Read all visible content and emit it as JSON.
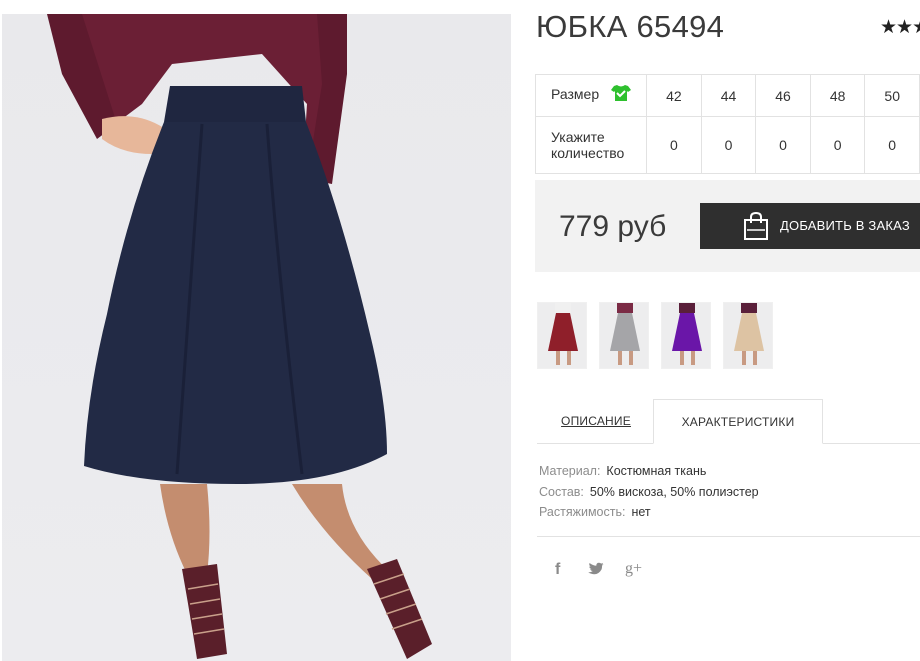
{
  "product": {
    "title": "ЮБКА 65494",
    "rating": "★★★"
  },
  "size_table": {
    "size_label": "Размер",
    "size_icon": "tshirt-check-icon",
    "qty_label_line1": "Укажите",
    "qty_label_line2": "количество",
    "sizes": [
      "42",
      "44",
      "46",
      "48",
      "50"
    ],
    "quantities": [
      "0",
      "0",
      "0",
      "0",
      "0"
    ]
  },
  "purchase": {
    "price": "779 руб",
    "add_button_label": "ДОБАВИТЬ В ЗАКАЗ",
    "add_button_icon": "shopping-bag-icon"
  },
  "thumbnails": [
    {
      "color": "#8f1f2a",
      "top_color": "#f0f0f0"
    },
    {
      "color": "#a5a5a8",
      "top_color": "#7b2b45"
    },
    {
      "color": "#6a16a8",
      "top_color": "#5a1f3a"
    },
    {
      "color": "#ddc3a3",
      "top_color": "#5a1f3a"
    }
  ],
  "tabs": {
    "description": "ОПИСАНИЕ",
    "characteristics": "ХАРАКТЕРИСТИКИ"
  },
  "specs": [
    {
      "key": "Материал:",
      "value": "Костюмная ткань"
    },
    {
      "key": "Состав:",
      "value": "50% вискоза, 50% полиэстер"
    },
    {
      "key": "Растяжимость:",
      "value": "нет"
    }
  ],
  "social": {
    "facebook": "f",
    "twitter": "twitter-bird-icon",
    "google_plus": "g+"
  },
  "colors": {
    "skirt": "#222a45",
    "top": "#6b1f35",
    "button_bg": "#2f2f2f",
    "accent_green": "#2ec02e"
  }
}
